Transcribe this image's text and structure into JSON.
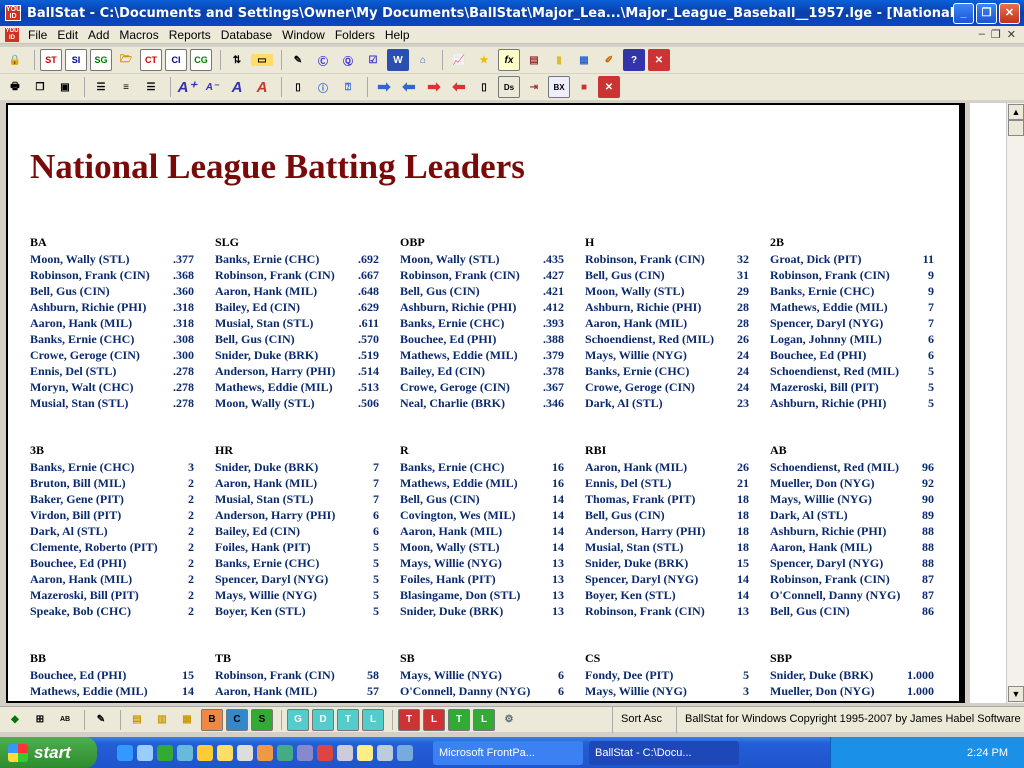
{
  "window": {
    "title": "BallStat -  C:\\Documents and Settings\\Owner\\My Documents\\BallStat\\Major_Lea...\\Major_League_Baseball__1957.lge  - [National League Batting L..."
  },
  "menu": [
    "File",
    "Edit",
    "Add",
    "Macros",
    "Reports",
    "Database",
    "Window",
    "Folders",
    "Help"
  ],
  "toolbar1": [
    "ST",
    "SI",
    "SG",
    "CT",
    "CI",
    "CG"
  ],
  "document": {
    "title": "National League Batting Leaders",
    "sections": [
      {
        "label": "BA",
        "rows": [
          [
            "Moon, Wally (STL)",
            ".377"
          ],
          [
            "Robinson, Frank (CIN)",
            ".368"
          ],
          [
            "Bell, Gus (CIN)",
            ".360"
          ],
          [
            "Ashburn, Richie (PHI)",
            ".318"
          ],
          [
            "Aaron, Hank (MIL)",
            ".318"
          ],
          [
            "Banks, Ernie (CHC)",
            ".308"
          ],
          [
            "Crowe, Geroge (CIN)",
            ".300"
          ],
          [
            "Ennis, Del (STL)",
            ".278"
          ],
          [
            "Moryn, Walt (CHC)",
            ".278"
          ],
          [
            "Musial, Stan (STL)",
            ".278"
          ]
        ]
      },
      {
        "label": "SLG",
        "rows": [
          [
            "Banks, Ernie (CHC)",
            ".692"
          ],
          [
            "Robinson, Frank (CIN)",
            ".667"
          ],
          [
            "Aaron, Hank (MIL)",
            ".648"
          ],
          [
            "Bailey, Ed (CIN)",
            ".629"
          ],
          [
            "Musial, Stan (STL)",
            ".611"
          ],
          [
            "Bell, Gus (CIN)",
            ".570"
          ],
          [
            "Snider, Duke (BRK)",
            ".519"
          ],
          [
            "Anderson, Harry (PHI)",
            ".514"
          ],
          [
            "Mathews, Eddie (MIL)",
            ".513"
          ],
          [
            "Moon, Wally (STL)",
            ".506"
          ]
        ]
      },
      {
        "label": "OBP",
        "rows": [
          [
            "Moon, Wally (STL)",
            ".435"
          ],
          [
            "Robinson, Frank (CIN)",
            ".427"
          ],
          [
            "Bell, Gus (CIN)",
            ".421"
          ],
          [
            "Ashburn, Richie (PHI)",
            ".412"
          ],
          [
            "Banks, Ernie (CHC)",
            ".393"
          ],
          [
            "Bouchee, Ed (PHI)",
            ".388"
          ],
          [
            "Mathews, Eddie (MIL)",
            ".379"
          ],
          [
            "Bailey, Ed (CIN)",
            ".378"
          ],
          [
            "Crowe, Geroge (CIN)",
            ".367"
          ],
          [
            "Neal, Charlie (BRK)",
            ".346"
          ]
        ]
      },
      {
        "label": "H",
        "rows": [
          [
            "Robinson, Frank (CIN)",
            "32"
          ],
          [
            "Bell, Gus (CIN)",
            "31"
          ],
          [
            "Moon, Wally (STL)",
            "29"
          ],
          [
            "Ashburn, Richie (PHI)",
            "28"
          ],
          [
            "Aaron, Hank (MIL)",
            "28"
          ],
          [
            "Schoendienst, Red (MIL)",
            "26"
          ],
          [
            "Mays, Willie (NYG)",
            "24"
          ],
          [
            "Banks, Ernie (CHC)",
            "24"
          ],
          [
            "Crowe, Geroge (CIN)",
            "24"
          ],
          [
            "Dark, Al (STL)",
            "23"
          ]
        ]
      },
      {
        "label": "2B",
        "rows": [
          [
            "Groat, Dick (PIT)",
            "11"
          ],
          [
            "Robinson, Frank (CIN)",
            "9"
          ],
          [
            "Banks, Ernie (CHC)",
            "9"
          ],
          [
            "Mathews, Eddie (MIL)",
            "7"
          ],
          [
            "Spencer, Daryl (NYG)",
            "7"
          ],
          [
            "Logan, Johnny (MIL)",
            "6"
          ],
          [
            "Bouchee, Ed (PHI)",
            "6"
          ],
          [
            "Schoendienst, Red (MIL)",
            "5"
          ],
          [
            "Mazeroski, Bill (PIT)",
            "5"
          ],
          [
            "Ashburn, Richie (PHI)",
            "5"
          ]
        ]
      },
      {
        "label": "3B",
        "rows": [
          [
            "Banks, Ernie (CHC)",
            "3"
          ],
          [
            "Bruton, Bill (MIL)",
            "2"
          ],
          [
            "Baker, Gene (PIT)",
            "2"
          ],
          [
            "Virdon, Bill (PIT)",
            "2"
          ],
          [
            "Dark, Al (STL)",
            "2"
          ],
          [
            "Clemente, Roberto (PIT)",
            "2"
          ],
          [
            "Bouchee, Ed (PHI)",
            "2"
          ],
          [
            "Aaron, Hank (MIL)",
            "2"
          ],
          [
            "Mazeroski, Bill (PIT)",
            "2"
          ],
          [
            "Speake, Bob (CHC)",
            "2"
          ]
        ]
      },
      {
        "label": "HR",
        "rows": [
          [
            "Snider, Duke (BRK)",
            "7"
          ],
          [
            "Aaron, Hank (MIL)",
            "7"
          ],
          [
            "Musial, Stan (STL)",
            "7"
          ],
          [
            "Anderson, Harry (PHI)",
            "6"
          ],
          [
            "Bailey, Ed (CIN)",
            "6"
          ],
          [
            "Foiles, Hank (PIT)",
            "5"
          ],
          [
            "Banks, Ernie (CHC)",
            "5"
          ],
          [
            "Spencer, Daryl (NYG)",
            "5"
          ],
          [
            "Mays, Willie (NYG)",
            "5"
          ],
          [
            "Boyer, Ken (STL)",
            "5"
          ]
        ]
      },
      {
        "label": "R",
        "rows": [
          [
            "Banks, Ernie (CHC)",
            "16"
          ],
          [
            "Mathews, Eddie (MIL)",
            "16"
          ],
          [
            "Bell, Gus (CIN)",
            "14"
          ],
          [
            "Covington, Wes (MIL)",
            "14"
          ],
          [
            "Aaron, Hank (MIL)",
            "14"
          ],
          [
            "Moon, Wally (STL)",
            "14"
          ],
          [
            "Mays, Willie (NYG)",
            "13"
          ],
          [
            "Foiles, Hank (PIT)",
            "13"
          ],
          [
            "Blasingame, Don (STL)",
            "13"
          ],
          [
            "Snider, Duke (BRK)",
            "13"
          ]
        ]
      },
      {
        "label": "RBI",
        "rows": [
          [
            "Aaron, Hank (MIL)",
            "26"
          ],
          [
            "Ennis, Del (STL)",
            "21"
          ],
          [
            "Thomas, Frank (PIT)",
            "18"
          ],
          [
            "Bell, Gus (CIN)",
            "18"
          ],
          [
            "Anderson, Harry (PHI)",
            "18"
          ],
          [
            "Musial, Stan (STL)",
            "18"
          ],
          [
            "Snider, Duke (BRK)",
            "15"
          ],
          [
            "Spencer, Daryl (NYG)",
            "14"
          ],
          [
            "Boyer, Ken (STL)",
            "14"
          ],
          [
            "Robinson, Frank (CIN)",
            "13"
          ]
        ]
      },
      {
        "label": "AB",
        "rows": [
          [
            "Schoendienst, Red (MIL)",
            "96"
          ],
          [
            "Mueller, Don (NYG)",
            "92"
          ],
          [
            "Mays, Willie (NYG)",
            "90"
          ],
          [
            "Dark, Al (STL)",
            "89"
          ],
          [
            "Ashburn, Richie (PHI)",
            "88"
          ],
          [
            "Aaron, Hank (MIL)",
            "88"
          ],
          [
            "Spencer, Daryl (NYG)",
            "88"
          ],
          [
            "Robinson, Frank (CIN)",
            "87"
          ],
          [
            "O'Connell, Danny (NYG)",
            "87"
          ],
          [
            "Bell, Gus (CIN)",
            "86"
          ]
        ]
      },
      {
        "label": "BB",
        "rows": [
          [
            "Bouchee, Ed (PHI)",
            "15"
          ],
          [
            "Mathews, Eddie (MIL)",
            "14"
          ]
        ]
      },
      {
        "label": "TB",
        "rows": [
          [
            "Robinson, Frank (CIN)",
            "58"
          ],
          [
            "Aaron, Hank (MIL)",
            "57"
          ]
        ]
      },
      {
        "label": "SB",
        "rows": [
          [
            "Mays, Willie (NYG)",
            "6"
          ],
          [
            "O'Connell, Danny (NYG)",
            "6"
          ]
        ]
      },
      {
        "label": "CS",
        "rows": [
          [
            "Fondy, Dee (PIT)",
            "5"
          ],
          [
            "Mays, Willie (NYG)",
            "3"
          ]
        ]
      },
      {
        "label": "SBP",
        "rows": [
          [
            "Snider, Duke (BRK)",
            "1.000"
          ],
          [
            "Mueller, Don (NYG)",
            "1.000"
          ]
        ]
      }
    ]
  },
  "bottom": {
    "sort_label": "Sort Asc",
    "copyright": "BallStat for Windows  Copyright 1995-2007 by James Habel Software"
  },
  "taskbar": {
    "start": "start",
    "tasks": [
      "Microsoft FrontPa...",
      "BallStat - C:\\Docu..."
    ],
    "clock": "2:24 PM"
  },
  "colors": {
    "title_maroon": "#7a0a0a",
    "player_navy": "#0a2a6e"
  }
}
